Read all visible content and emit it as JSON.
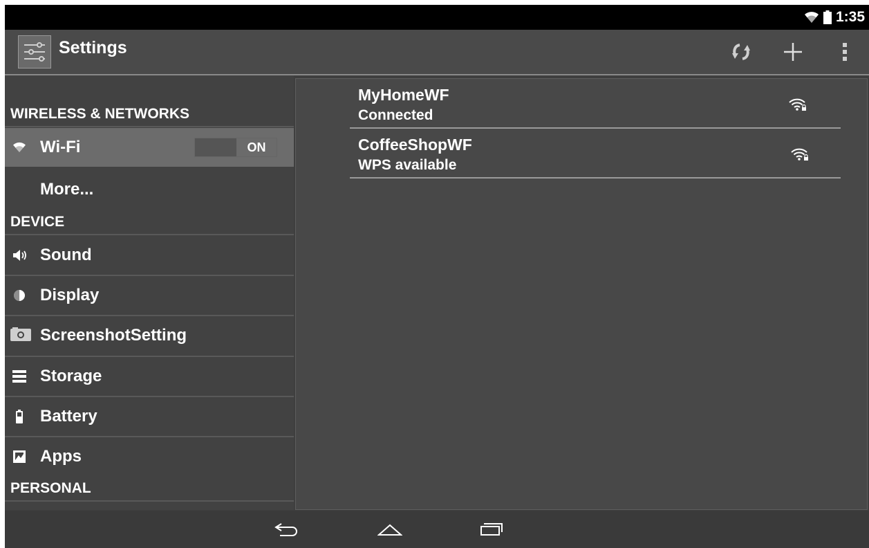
{
  "status_bar": {
    "time": "1:35",
    "wifi_icon": "wifi-icon",
    "battery_icon": "battery-icon"
  },
  "action_bar": {
    "title": "Settings",
    "app_icon": "settings-sliders-icon",
    "actions": [
      "wps-refresh-icon",
      "add-icon",
      "overflow-menu-icon"
    ]
  },
  "sidebar": {
    "wireless_header": "WIRELESS & NETWORKS",
    "wifi": {
      "label": "Wi-Fi",
      "toggle": "ON",
      "icon": "wifi-icon"
    },
    "more": {
      "label": "More..."
    },
    "device_header": "DEVICE",
    "items": [
      {
        "label": "Sound",
        "icon": "speaker-icon"
      },
      {
        "label": "Display",
        "icon": "brightness-icon"
      },
      {
        "label": "ScreenshotSetting",
        "icon": "camera-icon"
      },
      {
        "label": "Storage",
        "icon": "storage-icon"
      },
      {
        "label": "Battery",
        "icon": "battery-icon"
      },
      {
        "label": "Apps",
        "icon": "apps-icon"
      }
    ],
    "personal_header": "PERSONAL"
  },
  "networks": [
    {
      "name": "MyHomeWF",
      "status": "Connected",
      "icon": "wifi-locked-icon"
    },
    {
      "name": "CoffeeShopWF",
      "status": "WPS available",
      "icon": "wifi-locked-icon"
    }
  ],
  "nav_bar": {
    "buttons": [
      "back-icon",
      "home-icon",
      "recents-icon"
    ]
  }
}
